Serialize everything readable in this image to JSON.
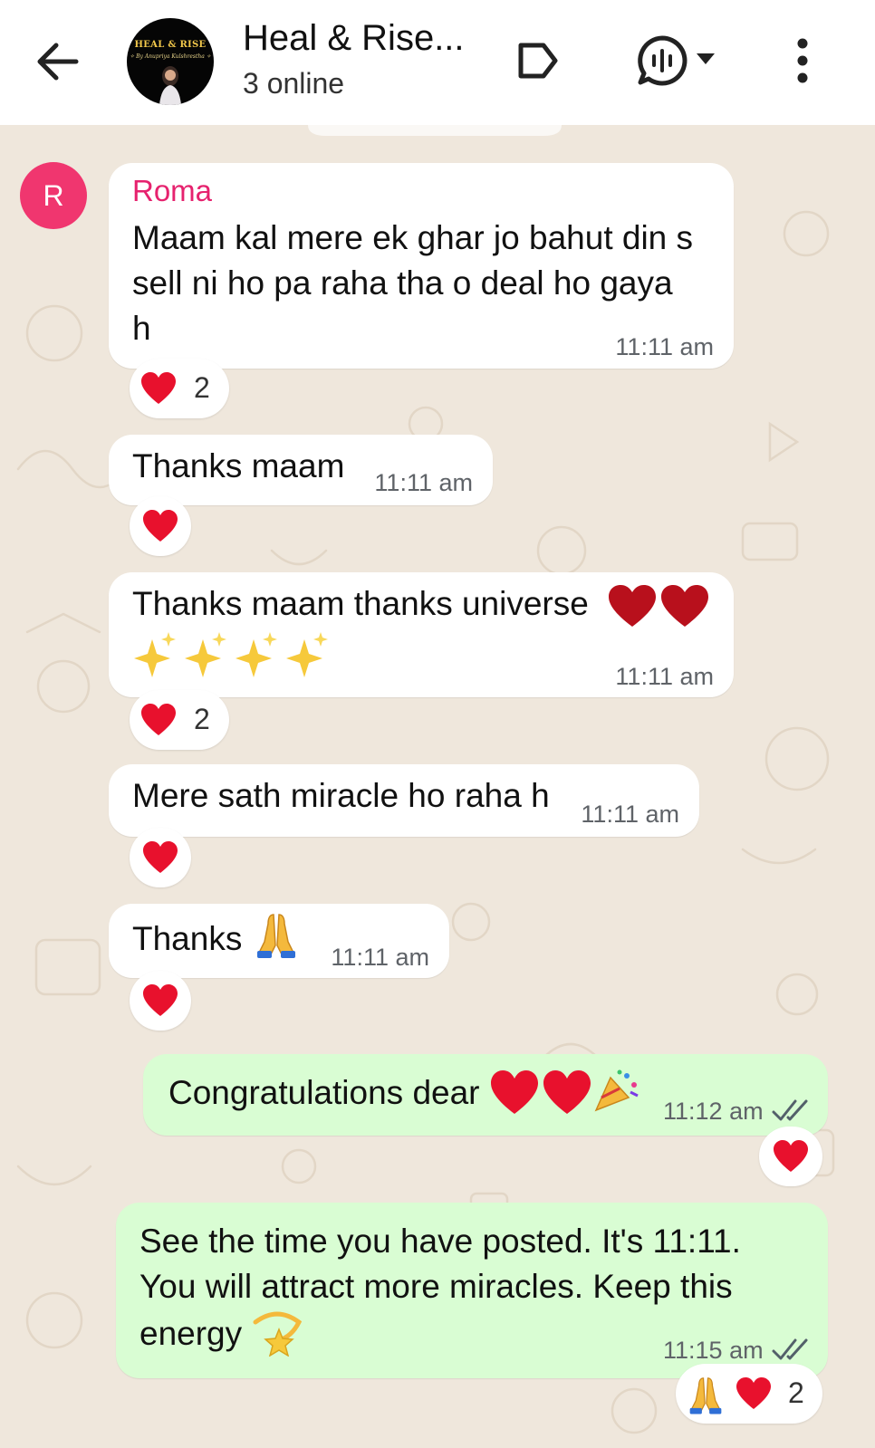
{
  "header": {
    "title": "Heal & Rise...",
    "subtitle": "3 online",
    "avatar_brand": "HEAL & RISE",
    "avatar_tagline": "✧ By Anupriya Kulshrestha ✧",
    "icons": [
      "back-arrow-icon",
      "label-icon",
      "voice-chat-icon",
      "dropdown-icon",
      "more-vert-icon"
    ]
  },
  "messages": [
    {
      "sender": "Roma",
      "avatar_letter": "R",
      "lines": [
        "Maam kal mere ek ghar jo bahut din s",
        "sell ni ho pa raha tha o deal ho gaya",
        "h"
      ],
      "time": "11:11 am",
      "reaction_count": "2"
    },
    {
      "text": "Thanks maam",
      "time": "11:11 am"
    },
    {
      "text": "Thanks maam thanks universe",
      "time": "11:11 am",
      "reaction_count": "2"
    },
    {
      "text": "Mere sath miracle ho raha h",
      "time": "11:11 am"
    },
    {
      "text": "Thanks",
      "time": "11:11 am"
    },
    {
      "text": "Congratulations dear",
      "time": "11:12 am",
      "outgoing": true
    },
    {
      "lines": [
        "See the time you have posted. It's 11:11.",
        "You will attract more miracles. Keep this",
        "energy"
      ],
      "time": "11:15 am",
      "outgoing": true,
      "reaction_count": "2"
    }
  ],
  "colors": {
    "chat_bg": "#efe7dc",
    "incoming_bubble": "#ffffff",
    "outgoing_bubble": "#d9fdd3",
    "sender_name": "#e6226e",
    "avatar_bg": "#f0366f",
    "read_tick": "#53606a"
  }
}
